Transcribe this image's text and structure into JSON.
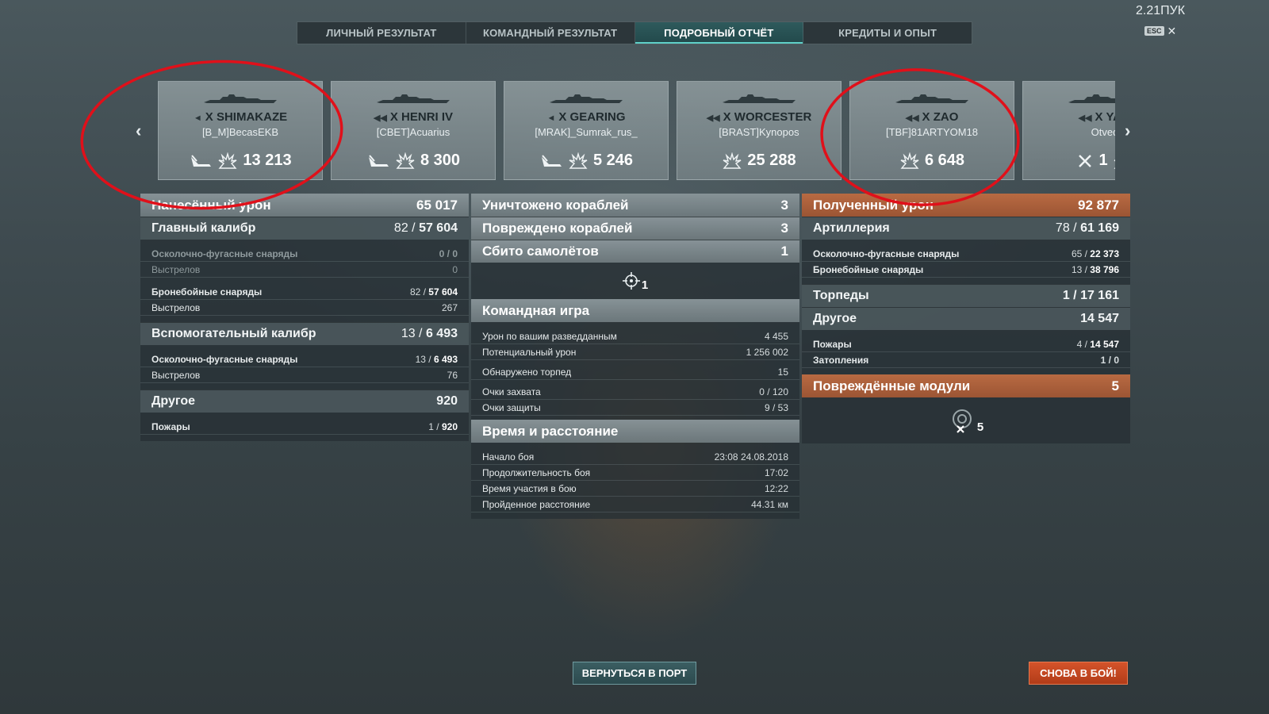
{
  "version": "2.21ПУК",
  "esc_key": "ESC",
  "tabs": [
    {
      "label": "ЛИЧНЫЙ РЕЗУЛЬТАТ",
      "active": false
    },
    {
      "label": "КОМАНДНЫЙ РЕЗУЛЬТАТ",
      "active": false
    },
    {
      "label": "ПОДРОБНЫЙ ОТЧЁТ",
      "active": true
    },
    {
      "label": "КРЕДИТЫ И ОПЫТ",
      "active": false
    }
  ],
  "ships": [
    {
      "tier": "X",
      "name": "SHIMAKAZE",
      "player": "[B_M]BecasEKB",
      "damage": "13 213",
      "icon": "destroyer-icon"
    },
    {
      "tier": "X",
      "name": "HENRI IV",
      "player": "[CBET]Acuarius",
      "damage": "8 300",
      "icon": "cruiser-icon"
    },
    {
      "tier": "X",
      "name": "GEARING",
      "player": "[MRAK]_Sumrak_rus_",
      "damage": "5 246",
      "icon": "destroyer-icon"
    },
    {
      "tier": "X",
      "name": "WORCESTER",
      "player": "[BRAST]Kynopos",
      "damage": "25 288",
      "icon": "cruiser-icon"
    },
    {
      "tier": "X",
      "name": "ZAO",
      "player": "[TBF]81ARTYOM18",
      "damage": "6 648",
      "icon": "cruiser-icon"
    },
    {
      "tier": "X",
      "name": "YAM",
      "player": "Otved",
      "damage": "",
      "kills": "1",
      "icon": "cruiser-icon"
    }
  ],
  "damage_dealt": {
    "title": "Нанесённый урон",
    "total": "65 017",
    "main_caliber": {
      "label": "Главный калибр",
      "hits": "82 /",
      "value": "57 604"
    },
    "he_shells": {
      "label": "Осколочно-фугасные снаряды",
      "value": "0 / 0"
    },
    "he_shots": {
      "label": "Выстрелов",
      "value": "0"
    },
    "ap_shells": {
      "label": "Бронебойные снаряды",
      "hits": "82 /",
      "value": "57 604"
    },
    "ap_shots": {
      "label": "Выстрелов",
      "value": "267"
    },
    "secondary": {
      "label": "Вспомогательный калибр",
      "hits": "13 /",
      "value": "6 493"
    },
    "sec_he": {
      "label": "Осколочно-фугасные снаряды",
      "hits": "13 /",
      "value": "6 493"
    },
    "sec_shots": {
      "label": "Выстрелов",
      "value": "76"
    },
    "other": {
      "label": "Другое",
      "value": "920"
    },
    "fires": {
      "label": "Пожары",
      "hits": "1 /",
      "value": "920"
    }
  },
  "middle": {
    "destroyed": {
      "label": "Уничтожено кораблей",
      "value": "3"
    },
    "damaged": {
      "label": "Повреждено кораблей",
      "value": "3"
    },
    "planes": {
      "label": "Сбито самолётов",
      "value": "1"
    },
    "crosshair_count": "1",
    "teamplay": {
      "title": "Командная игра",
      "spotting_damage": {
        "label": "Урон по вашим разведданным",
        "value": "4 455"
      },
      "potential_damage": {
        "label": "Потенциальный урон",
        "value": "1 256 002"
      },
      "torpedoes_spotted": {
        "label": "Обнаружено торпед",
        "value": "15"
      },
      "capture_points": {
        "label": "Очки захвата",
        "value": "0 / 120"
      },
      "defense_points": {
        "label": "Очки защиты",
        "value": "9 / 53"
      }
    },
    "time": {
      "title": "Время и расстояние",
      "start": {
        "label": "Начало боя",
        "value": "23:08  24.08.2018"
      },
      "duration": {
        "label": "Продолжительность боя",
        "value": "17:02"
      },
      "participation": {
        "label": "Время участия в бою",
        "value": "12:22"
      },
      "distance": {
        "label": "Пройденное расстояние",
        "value": "44.31 км"
      }
    }
  },
  "damage_received": {
    "title": "Полученный урон",
    "total": "92 877",
    "artillery": {
      "label": "Артиллерия",
      "hits": "78 /",
      "value": "61 169"
    },
    "he": {
      "label": "Осколочно-фугасные снаряды",
      "hits": "65 /",
      "value": "22 373"
    },
    "ap": {
      "label": "Бронебойные снаряды",
      "hits": "13 /",
      "value": "38 796"
    },
    "torpedoes": {
      "label": "Торпеды",
      "value": "1 / 17 161"
    },
    "other": {
      "label": "Другое",
      "value": "14 547"
    },
    "fires": {
      "label": "Пожары",
      "hits": "4 /",
      "value": "14 547"
    },
    "flooding": {
      "label": "Затопления",
      "value": "1 / 0"
    },
    "modules": {
      "label": "Повреждённые модули",
      "value": "5"
    },
    "module_icon_count": "5"
  },
  "buttons": {
    "port": "ВЕРНУТЬСЯ В ПОРТ",
    "battle": "СНОВА В БОЙ!"
  },
  "colors": {
    "accent_teal": "#5fd0c8",
    "orange_header": "#b86a42",
    "battle_button": "#d4532a",
    "annotation_red": "#e0101a"
  }
}
